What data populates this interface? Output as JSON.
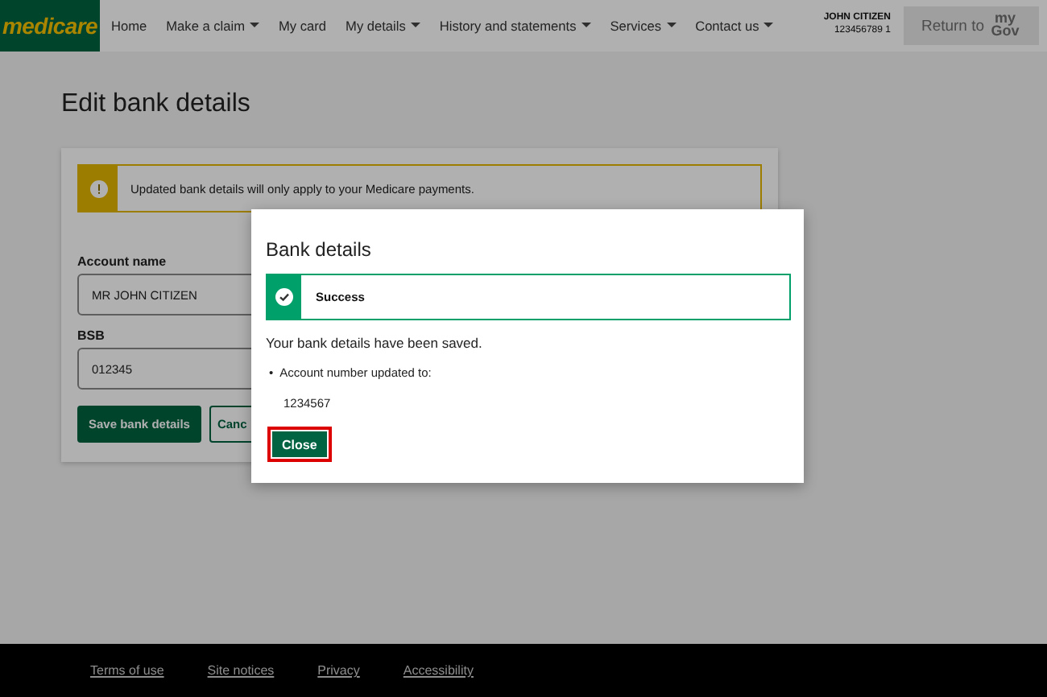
{
  "header": {
    "logo": "medicare",
    "nav": [
      {
        "label": "Home",
        "dropdown": false
      },
      {
        "label": "Make a claim",
        "dropdown": true
      },
      {
        "label": "My card",
        "dropdown": false
      },
      {
        "label": "My details",
        "dropdown": true
      },
      {
        "label": "History and statements",
        "dropdown": true
      },
      {
        "label": "Services",
        "dropdown": true
      },
      {
        "label": "Contact us",
        "dropdown": true
      }
    ],
    "user": {
      "name": "JOHN CITIZEN",
      "number": "123456789 1"
    },
    "return_button": {
      "label": "Return to",
      "logo": "my Gov",
      "disabled": true
    }
  },
  "page": {
    "title": "Edit bank details",
    "alert": {
      "kind": "warning",
      "text": "Updated bank details will only apply to your Medicare payments."
    },
    "fields": [
      {
        "label": "Account name",
        "value": "MR JOHN CITIZEN"
      },
      {
        "label": "BSB",
        "value": "012345"
      }
    ],
    "buttons": [
      {
        "label": "Save bank details",
        "kind": "primary"
      },
      {
        "label": "Canc",
        "kind": "secondary"
      }
    ]
  },
  "modal": {
    "title": "Bank details",
    "status": {
      "kind": "success",
      "text": "Success"
    },
    "message": "Your bank details have been saved.",
    "items": [
      {
        "marker": "•",
        "text": "Account number updated to:"
      }
    ],
    "value": "1234567",
    "close_button": {
      "label": "Close",
      "focused": true
    }
  },
  "footer": {
    "links": [
      "Terms of use",
      "Site notices",
      "Privacy",
      "Accessibility"
    ]
  }
}
